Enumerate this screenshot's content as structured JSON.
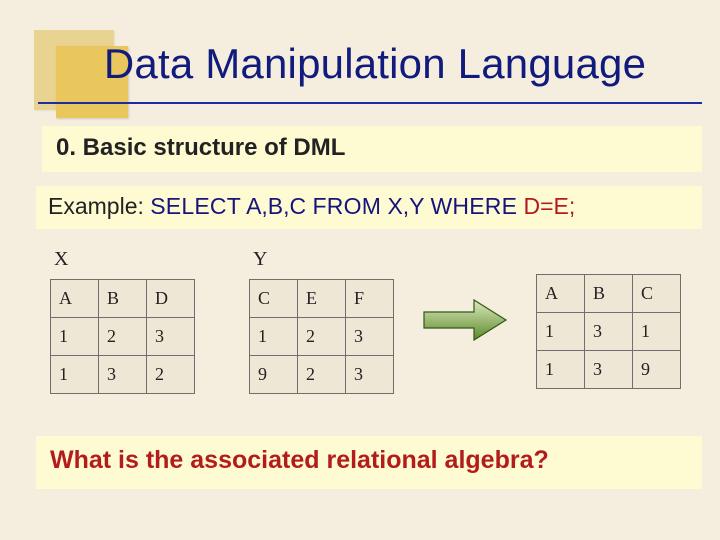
{
  "title": "Data Manipulation Language",
  "subtitle": "0. Basic structure of DML",
  "example": {
    "lead": "Example: ",
    "select_kw": "SELECT",
    "select_cols": " A,B,C ",
    "from_kw": "FROM",
    "from_tbls": " X,Y ",
    "where_kw": "WHERE",
    "sp": " ",
    "cond": "D=E;"
  },
  "tables": {
    "x": {
      "label": "X",
      "headers": [
        "A",
        "B",
        "D"
      ],
      "rows": [
        [
          "1",
          "2",
          "3"
        ],
        [
          "1",
          "3",
          "2"
        ]
      ]
    },
    "y": {
      "label": "Y",
      "headers": [
        "C",
        "E",
        "F"
      ],
      "rows": [
        [
          "1",
          "2",
          "3"
        ],
        [
          "9",
          "2",
          "3"
        ]
      ]
    },
    "result": {
      "headers": [
        "A",
        "B",
        "C"
      ],
      "rows": [
        [
          "1",
          "3",
          "1"
        ],
        [
          "1",
          "3",
          "9"
        ]
      ]
    }
  },
  "question": "What is the associated relational algebra?"
}
